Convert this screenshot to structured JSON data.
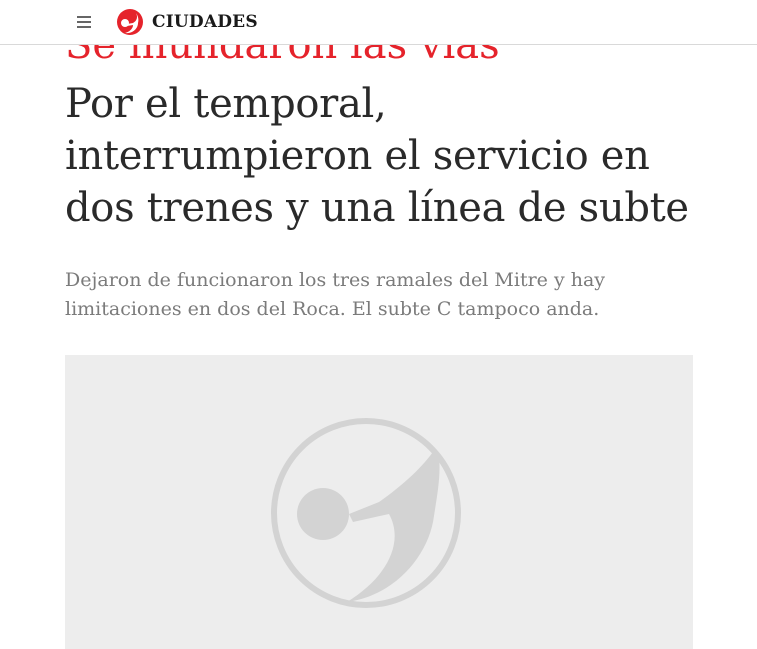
{
  "header": {
    "section": "CIUDADES",
    "menu_icon": "hamburger-menu-icon",
    "logo_icon": "clarin-logo-icon",
    "accent_color": "#e5232b"
  },
  "article": {
    "kicker": "Se inundaron las vías",
    "headline": "Por el temporal, interrumpieron el servicio en dos trenes y una línea de subte",
    "subtitle": "Dejaron de funcionaron los tres ramales del Mitre y hay limitaciones en dos del Roca. El subte C tampoco anda.",
    "media_placeholder_icon": "image-placeholder-logo-icon"
  }
}
